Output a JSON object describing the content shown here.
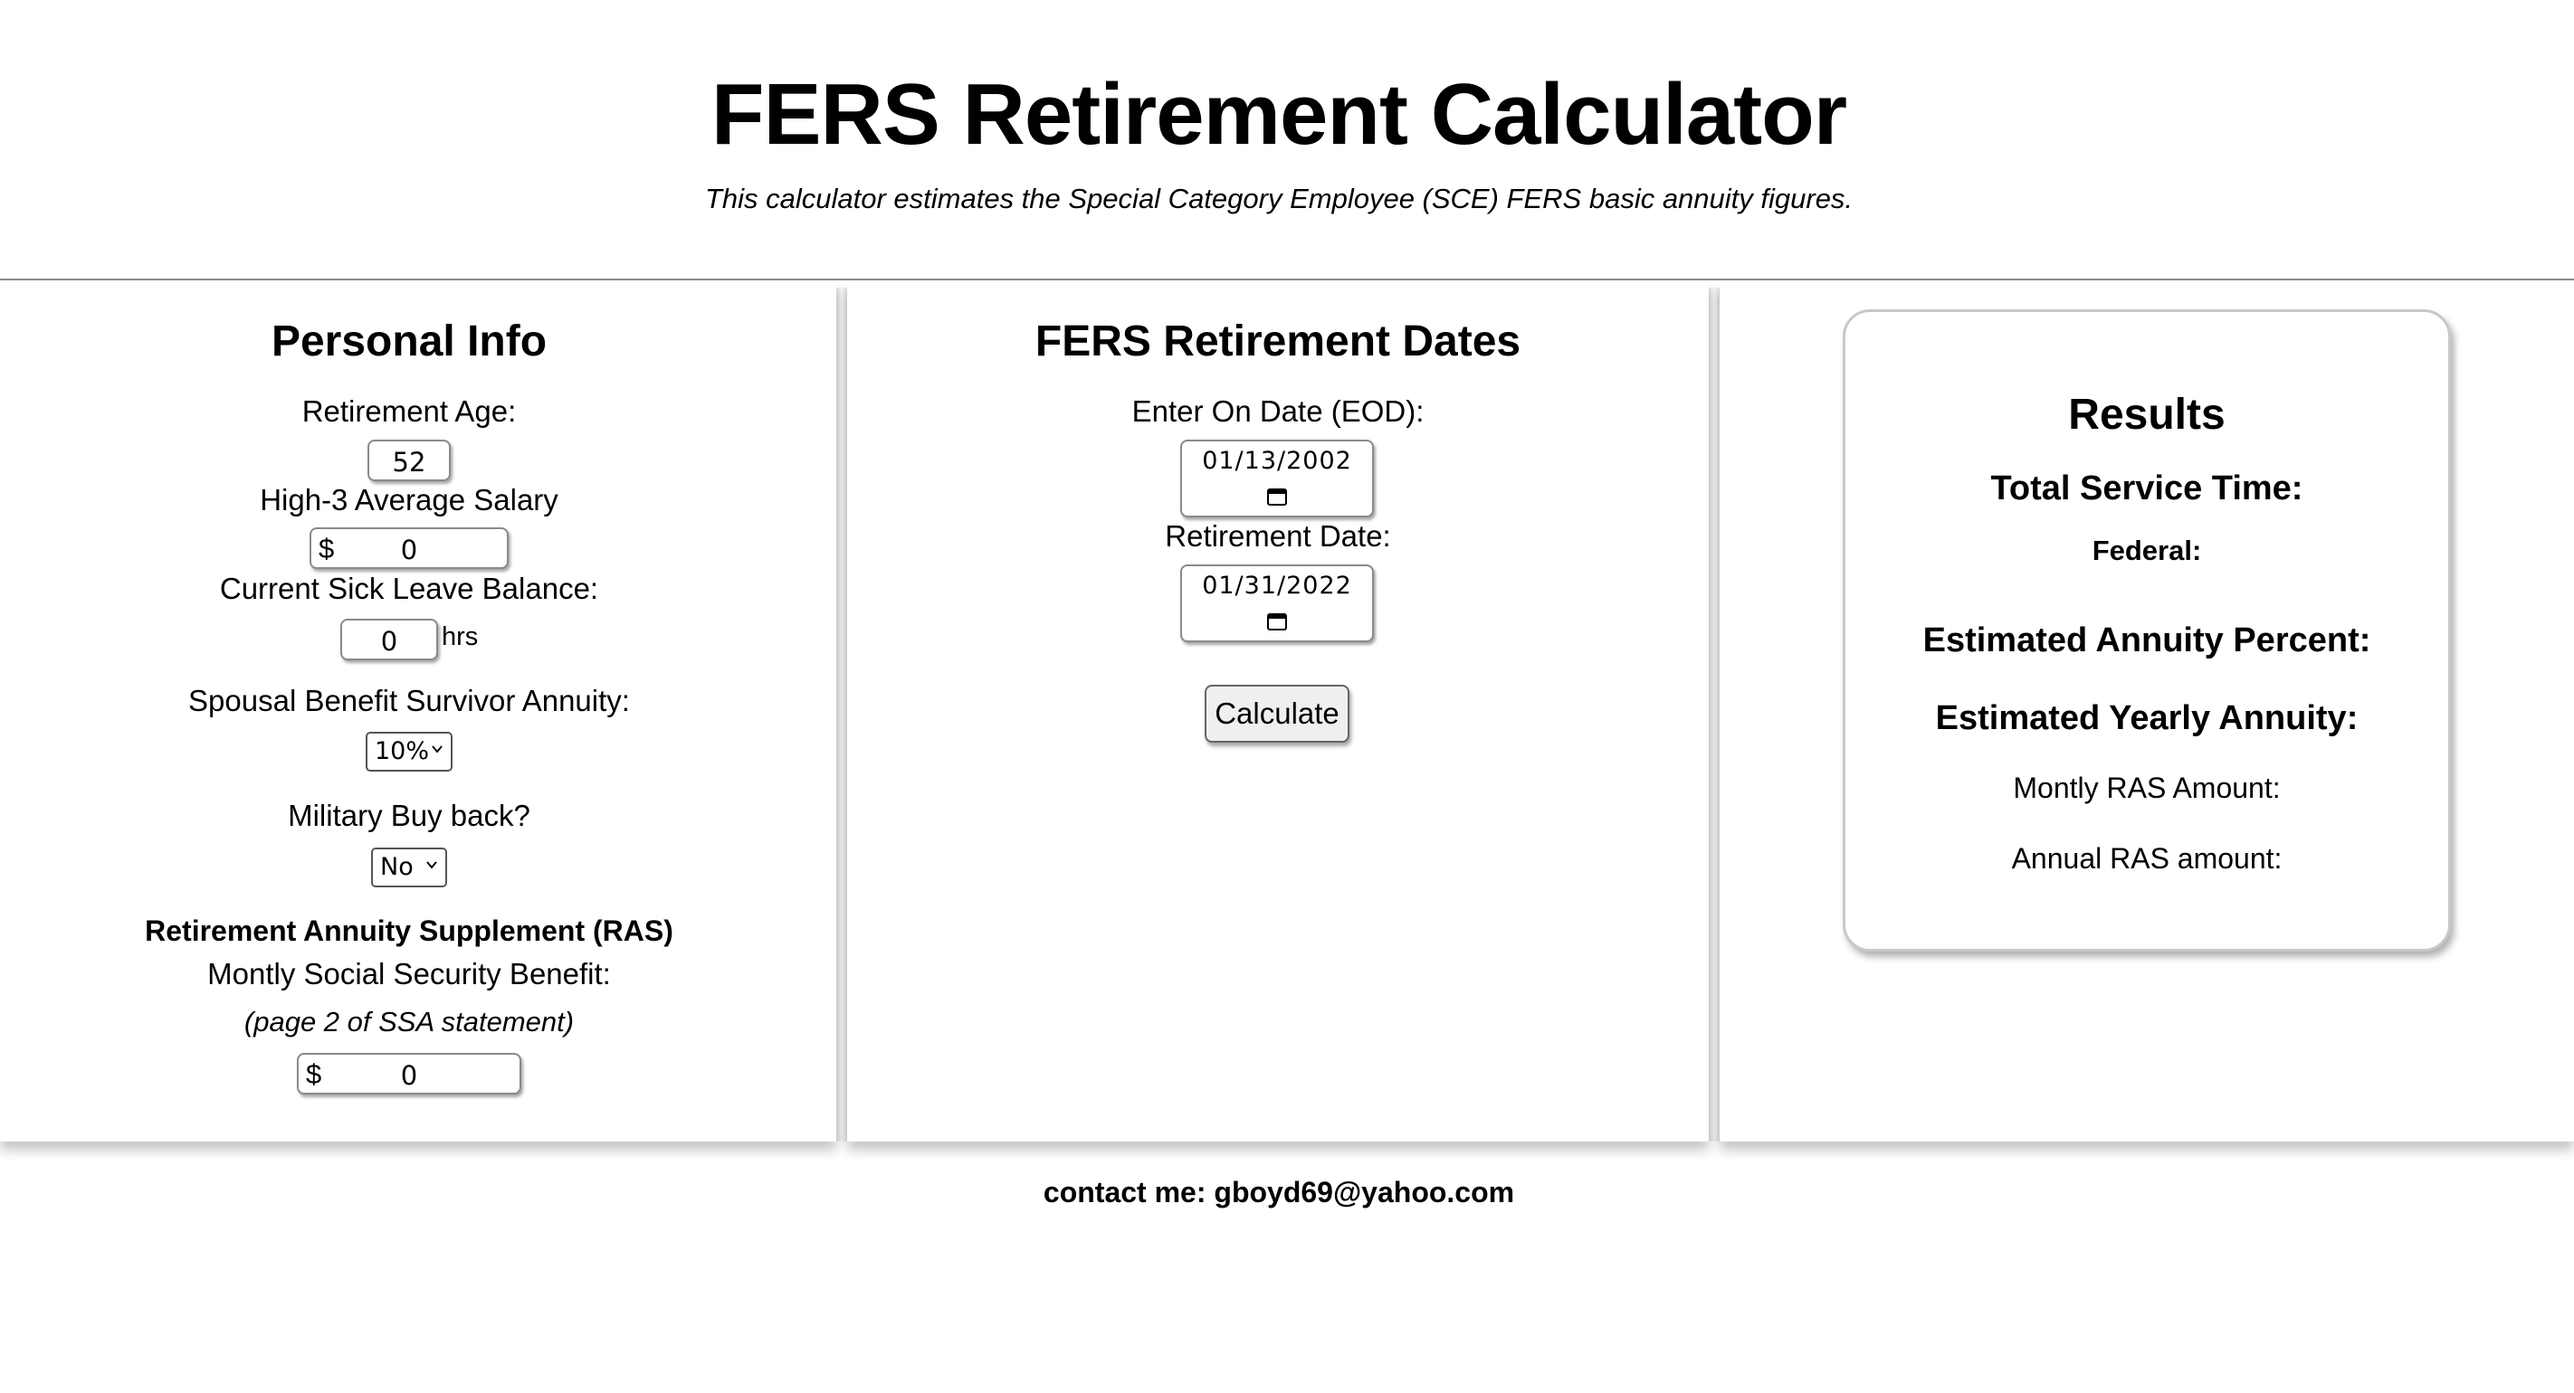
{
  "header": {
    "title": "FERS Retirement Calculator",
    "subtitle": "This calculator estimates the Special Category Employee (SCE) FERS basic annuity figures."
  },
  "personal_info": {
    "heading": "Personal Info",
    "retirement_age_label": "Retirement Age:",
    "retirement_age_value": "52",
    "high3_label": "High-3 Average Salary",
    "high3_prefix": "$",
    "high3_value": "0",
    "sick_leave_label": "Current Sick Leave Balance:",
    "sick_leave_value": "0",
    "sick_leave_unit": "hrs",
    "spousal_label": "Spousal Benefit Survivor Annuity:",
    "spousal_selected": "10%",
    "military_label": "Military Buy back?",
    "military_selected": "No",
    "ras_heading": "Retirement Annuity Supplement (RAS)",
    "ss_benefit_label": "Montly Social Security Benefit:",
    "ss_benefit_note": "(page 2 of SSA statement)",
    "ss_prefix": "$",
    "ss_value": "0"
  },
  "dates": {
    "heading": "FERS Retirement Dates",
    "eod_label": "Enter On Date (EOD):",
    "eod_value": "01/13/2002",
    "retirement_label": "Retirement Date:",
    "retirement_value": "01/31/2022",
    "calculate_label": "Calculate"
  },
  "results": {
    "heading": "Results",
    "total_service_label": "Total Service Time:",
    "federal_label": "Federal:",
    "annuity_percent_label": "Estimated Annuity Percent:",
    "yearly_annuity_label": "Estimated Yearly Annuity:",
    "monthly_ras_label": "Montly RAS Amount:",
    "annual_ras_label": "Annual RAS amount:"
  },
  "footer": {
    "contact": "contact me: gboyd69@yahoo.com"
  },
  "icons": {
    "calendar": "calendar-icon",
    "chevron": "chevron-down-icon"
  }
}
